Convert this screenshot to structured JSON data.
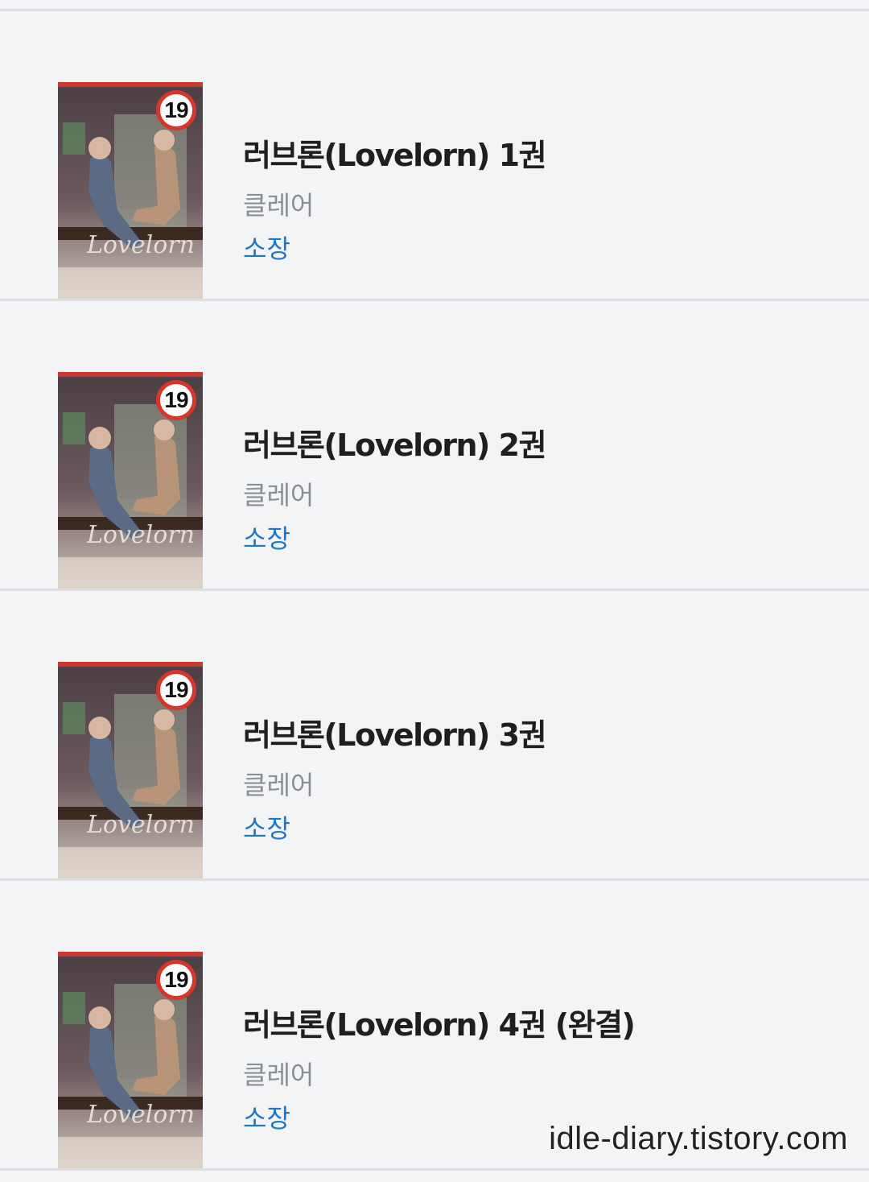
{
  "books": [
    {
      "title": "러브론(Lovelorn) 1권",
      "author": "클레어",
      "status": "소장",
      "age_rating": "19"
    },
    {
      "title": "러브론(Lovelorn) 2권",
      "author": "클레어",
      "status": "소장",
      "age_rating": "19"
    },
    {
      "title": "러브론(Lovelorn) 3권",
      "author": "클레어",
      "status": "소장",
      "age_rating": "19"
    },
    {
      "title": "러브론(Lovelorn) 4권 (완결)",
      "author": "클레어",
      "status": "소장",
      "age_rating": "19"
    }
  ],
  "cover_art_text": "Lovelorn",
  "watermark": "idle-diary.tistory.com",
  "colors": {
    "background": "#f3f4f6",
    "divider": "#dcdee2",
    "title": "#1f1f21",
    "author": "#8b8e93",
    "status": "#1d77c9",
    "badge_ring": "#d9362b"
  }
}
